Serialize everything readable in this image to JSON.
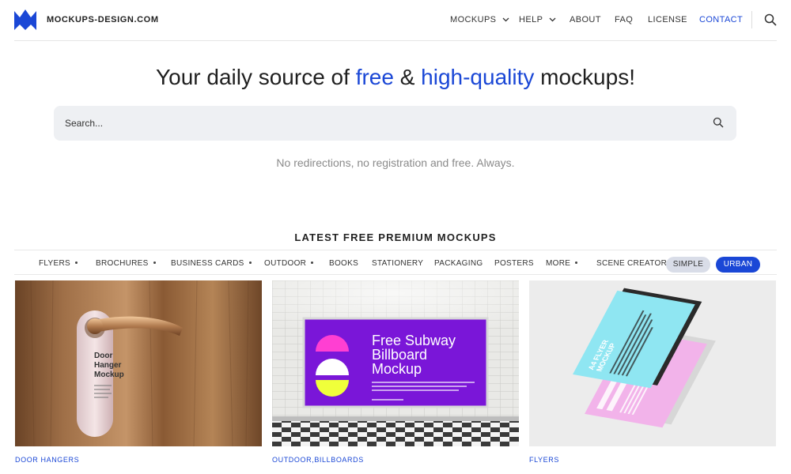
{
  "header": {
    "brand": "MOCKUPS-DESIGN.COM",
    "nav": {
      "mockups": "MOCKUPS",
      "help": "HELP",
      "about": "ABOUT",
      "faq": "FAQ",
      "license": "LICENSE",
      "contact": "CONTACT"
    },
    "icons": {
      "logo": "m-logo",
      "search": "search-icon",
      "dropdown": "chevron-down-icon"
    },
    "accent_color": "#1a47d6"
  },
  "hero": {
    "title_before": "Your daily source of ",
    "title_free": "free",
    "title_amp": " & ",
    "title_hq": "high-quality",
    "title_after": " mockups!",
    "search_placeholder": "Search...",
    "tagline": "No redirections, no registration and free. Always."
  },
  "section": {
    "title": "LATEST FREE PREMIUM MOCKUPS",
    "categories": {
      "flyers": "FLYERS",
      "brochures": "BROCHURES",
      "business_cards": "BUSINESS CARDS",
      "outdoor": "OUTDOOR",
      "books": "BOOKS",
      "stationery": "STATIONERY",
      "packaging": "PACKAGING",
      "posters": "POSTERS",
      "more": "MORE",
      "scene_creator": "SCENE CREATOR"
    },
    "pills": {
      "simple": "SIMPLE",
      "urban": "URBAN"
    }
  },
  "cards": [
    {
      "tag": "DOOR HANGERS",
      "image_text": [
        "Door",
        "Hanger",
        "Mockup"
      ]
    },
    {
      "tag_a": "OUTDOOR",
      "tag_sep": ",",
      "tag_b": "BILLBOARDS",
      "image_text": [
        "Free Subway",
        "Billboard",
        "Mockup"
      ]
    },
    {
      "tag": "FLYERS",
      "image_text": [
        "A4 FLYER",
        "MOCKUP"
      ]
    }
  ]
}
